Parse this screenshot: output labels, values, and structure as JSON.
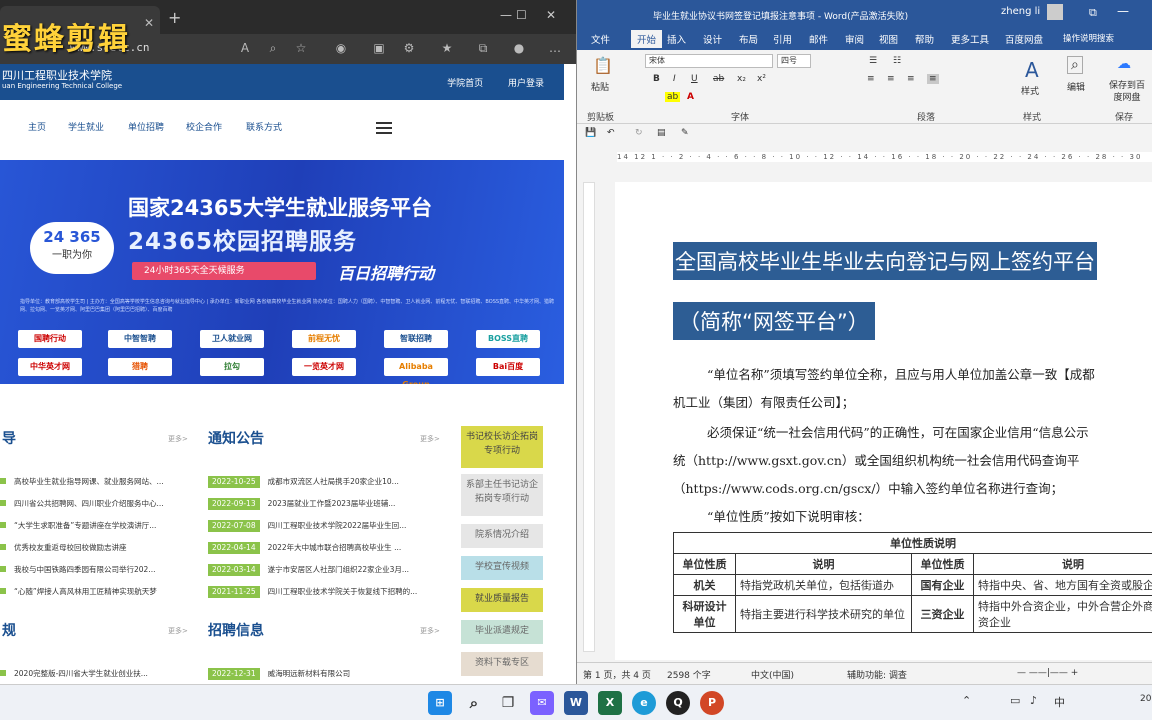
{
  "watermark": "蜜蜂剪辑",
  "browser": {
    "url": "www.scetc.cn",
    "site": {
      "logo_line1": "四川工程职业技术学院",
      "logo_line2": "uan Engineering Technical College",
      "header_links": [
        "学院首页",
        "用户登录"
      ],
      "nav": [
        "主页",
        "学生就业",
        "单位招聘",
        "校企合作",
        "联系方式"
      ]
    },
    "banner": {
      "title1": "国家24365大学生就业服务平台",
      "title2": "24365校园招聘服务",
      "circle_num": "24 365",
      "circle_text": "一职为你",
      "red_bar": "24小时365天全天候服务",
      "campaign": "百日招聘行动",
      "fine_print": "指导单位：教育部高校学生司 | 主办方：全国高等学校学生信息咨询与就业指导中心 | 承办单位：新职业网 各省级高校毕业生就业网 协办单位：国聘人力（国聘）、中智智聘、卫人就业网、前程无忧、智联招聘、BOSS直聘、中华英才网、猎聘网、拉勾网、一览英才网、阿里巴巴集团（阿里巴巴招聘）、百度百聘",
      "partners": [
        "国聘行动",
        "中智智聘",
        "卫人就业网",
        "前程无忧",
        "智联招聘",
        "BOSS直聘",
        "中华英才网",
        "猎聘",
        "拉勾",
        "一览英才网",
        "Alibaba Group",
        "Bai百度"
      ]
    },
    "sections": {
      "guide_title": "导",
      "guide_more": "更多>",
      "guide_items": [
        "高校毕业生就业指导网课、就业服务网站、...",
        "四川省公共招聘网、四川职业介绍服务中心...",
        "“大学生求职准备”专题讲座在学校演讲厅...",
        "优秀校友重返母校回校做励志讲座",
        "我校与中国铁路四季园有限公司举行202...",
        "“心随”焊接人高风林用工匠精神实现航天梦"
      ],
      "notice_title": "通知公告",
      "notice_more": "更多>",
      "notice_items": [
        {
          "date": "2022-10-25",
          "text": "成都市双流区人社局携手20家企业10..."
        },
        {
          "date": "2022-09-13",
          "text": "2023届就业工作暨2023届毕业班辅..."
        },
        {
          "date": "2022-07-08",
          "text": "四川工程职业技术学院2022届毕业生回..."
        },
        {
          "date": "2022-04-14",
          "text": "2022年大中城市联合招聘高校毕业生 ..."
        },
        {
          "date": "2022-03-14",
          "text": "遂宁市安居区人社部门组织22家企业3月..."
        },
        {
          "date": "2021-11-25",
          "text": "四川工程职业技术学院关于恢复线下招聘的..."
        }
      ],
      "rule_title": "规",
      "rule_more": "更多>",
      "rule_item": "2020完整版-四川省大学生就业创业扶...",
      "recruit_title": "招聘信息",
      "recruit_more": "更多>",
      "recruit_item": {
        "date": "2022-12-31",
        "text": "威海明远新材料有限公司"
      },
      "side_buttons": [
        "书记校长访企拓岗专项行动",
        "系部主任书记访企拓岗专项行动",
        "院系情况介绍",
        "学校宣传视频",
        "就业质量报告",
        "毕业派遣规定",
        "资料下载专区"
      ]
    }
  },
  "word": {
    "title": "毕业生就业协议书网签登记填报注意事项 - Word(产品激活失败)",
    "user": "zheng li",
    "menu": [
      "文件",
      "开始",
      "插入",
      "设计",
      "布局",
      "引用",
      "邮件",
      "审阅",
      "视图",
      "帮助",
      "更多工具",
      "百度网盘",
      "操作说明搜索"
    ],
    "font_name": "宋体",
    "font_size": "四号",
    "groups": [
      "剪贴板",
      "字体",
      "段落",
      "样式",
      "保存"
    ],
    "ribbon_big": [
      "粘贴",
      "样式",
      "编辑",
      "保存到百度网盘"
    ],
    "heading1": "全国高校毕业生毕业去向登记与网上签约平台",
    "heading2": "（简称“网签平台”）",
    "para1a": "“单位名称”须填写签约单位全称，且应与用人单位加盖公章一致【成都",
    "para1b": "机工业（集团）有限责任公司】；",
    "para2a": "必须保证“统一社会信用代码”的正确性，可在国家企业信用“信息公示",
    "para2b": "统（http://www.gsxt.gov.cn）或全国组织机构统一社会信用代码查询平",
    "para2c": "（https://www.cods.org.cn/gscx/）中输入签约单位名称进行查询；",
    "para3": "“单位性质”按如下说明审核：",
    "table": {
      "title": "单位性质说明",
      "h1": "单位性质",
      "h2": "说明",
      "h3": "单位性质",
      "h4": "说明",
      "r1c1": "机关",
      "r1c2": "特指党政机关单位，包括街道办",
      "r1c3": "国有企业",
      "r1c4": "特指中央、省、地方国有全资或股企业",
      "r2c1": "科研设计单位",
      "r2c2": "特指主要进行科学技术研究的单位",
      "r2c3": "三资企业",
      "r2c4": "特指中外合资企业，中外合营企外商独资企业"
    },
    "status": {
      "page": "第 1 页，共 4 页",
      "words": "2598 个字",
      "lang": "中文(中国)",
      "access": "辅助功能: 调查"
    }
  },
  "taskbar": {
    "tray_ime": "中",
    "time": "20"
  }
}
